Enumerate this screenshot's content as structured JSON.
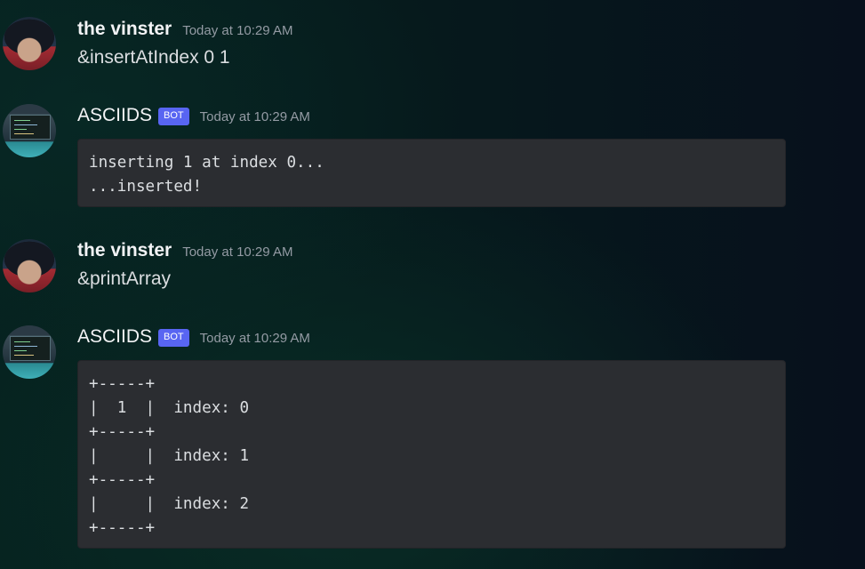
{
  "messages": [
    {
      "author": "the vinster",
      "timestamp": "Today at 10:29 AM",
      "text": "&insertAtIndex 0 1"
    },
    {
      "author": "ASCIIDS",
      "badge": "BOT",
      "timestamp": "Today at 10:29 AM",
      "code": "inserting 1 at index 0...\n...inserted!"
    },
    {
      "author": "the vinster",
      "timestamp": "Today at 10:29 AM",
      "text": "&printArray"
    },
    {
      "author": "ASCIIDS",
      "badge": "BOT",
      "timestamp": "Today at 10:29 AM",
      "code": "+-----+\n|  1  |  index: 0\n+-----+\n|     |  index: 1\n+-----+\n|     |  index: 2\n+-----+"
    }
  ],
  "colors": {
    "bot_badge": "#5865f2",
    "code_background": "#2b2d31",
    "timestamp": "#949ba4"
  }
}
